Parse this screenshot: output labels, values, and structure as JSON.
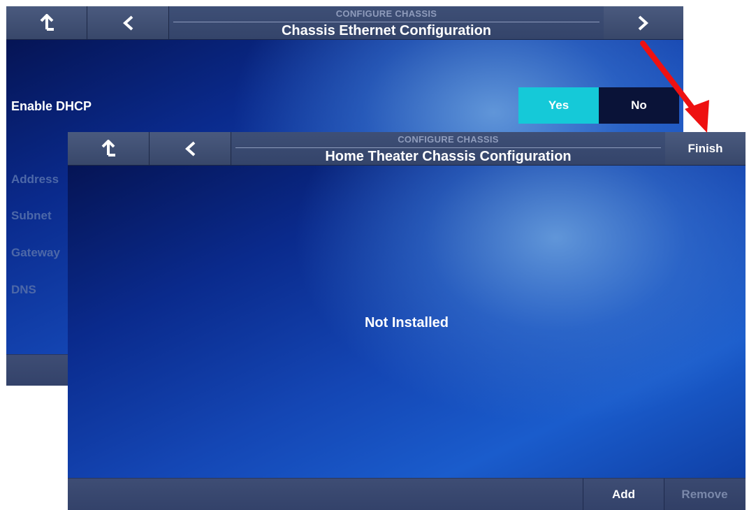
{
  "back_screen": {
    "header": {
      "subtitle": "CONFIGURE CHASSIS",
      "title": "Chassis Ethernet Configuration"
    },
    "dhcp": {
      "label": "Enable DHCP",
      "yes_label": "Yes",
      "no_label": "No",
      "selected": "Yes"
    },
    "fields": [
      "Address",
      "Subnet",
      "Gateway",
      "DNS"
    ]
  },
  "front_screen": {
    "header": {
      "subtitle": "CONFIGURE CHASSIS",
      "title": "Home Theater Chassis Configuration",
      "finish_label": "Finish"
    },
    "status_text": "Not Installed",
    "footer": {
      "add_label": "Add",
      "remove_label": "Remove"
    }
  },
  "colors": {
    "selected_toggle": "#15c9d8",
    "unselected_toggle": "#0a1338",
    "annotation_arrow": "#ee1111"
  },
  "icons": [
    "up-arrow-icon",
    "chevron-left-icon",
    "chevron-right-icon",
    "annotation-arrow"
  ]
}
